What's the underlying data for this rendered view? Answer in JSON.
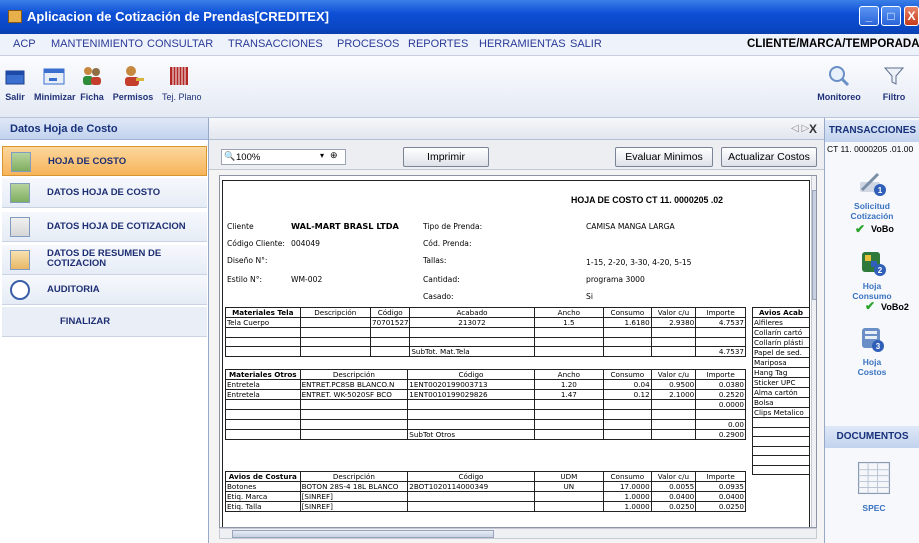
{
  "window": {
    "title": "Aplicacion de Cotización de Prendas[CREDITEX]",
    "minimize": "_",
    "maximize": "□",
    "close": "X"
  },
  "menu": {
    "items": [
      "ACP",
      "MANTENIMIENTO",
      "CONSULTAR",
      "TRANSACCIONES",
      "PROCESOS",
      "REPORTES",
      "HERRAMIENTAS",
      "SALIR"
    ],
    "context": "CLIENTE/MARCA/TEMPORADA"
  },
  "toolbar": {
    "left": [
      {
        "label": "Salir",
        "icon": "exit-icon"
      },
      {
        "label": "Minimizar",
        "icon": "minimize-window-icon"
      },
      {
        "label": "Ficha",
        "icon": "users-icon"
      },
      {
        "label": "Permisos",
        "icon": "user-key-icon"
      },
      {
        "label": "Tej. Plano",
        "icon": "barcode-icon"
      }
    ],
    "right": [
      {
        "label": "Monitoreo",
        "icon": "magnifier-icon"
      },
      {
        "label": "Filtro",
        "icon": "funnel-icon"
      }
    ]
  },
  "left_panel": {
    "title": "Datos Hoja de Costo",
    "items": [
      "HOJA DE COSTO",
      "DATOS HOJA DE COSTO",
      "DATOS HOJA DE COTIZACION",
      "DATOS DE RESUMEN DE COTIZACION",
      "AUDITORIA",
      "FINALIZAR"
    ],
    "active": "HOJA DE COSTO"
  },
  "doc": {
    "nav": "◁ ▷",
    "close": "X",
    "zoom": "100%",
    "print_btn": "Imprimir",
    "eval_btn": "Evaluar Minimos",
    "update_btn": "Actualizar Costos"
  },
  "report": {
    "title": "HOJA DE COSTO CT 11. 0000205 .02",
    "fields": [
      {
        "label": "Cliente",
        "value": "WAL-MART BRASL LTDA"
      },
      {
        "label": "Código Cliente:",
        "value": "004049"
      },
      {
        "label": "Diseño N°:",
        "value": ""
      },
      {
        "label": "Estilo N°:",
        "value": "WM-002"
      }
    ],
    "fields2": [
      {
        "label": "Tipo de Prenda:",
        "value": "CAMISA MANGA LARGA"
      },
      {
        "label": "Cód. Prenda:",
        "value": ""
      },
      {
        "label": "Tallas:",
        "value": "1-15, 2-20, 3-30, 4-20, 5-15"
      },
      {
        "label": "Cantidad:",
        "value": "programa 3000"
      },
      {
        "label": "Casado:",
        "value": "Si"
      }
    ],
    "telas": {
      "headers": [
        "Materiales Tela",
        "Descripción",
        "Código",
        "Acabado",
        "Ancho",
        "Consumo",
        "Valor c/u",
        "Importe"
      ],
      "rows": [
        [
          "Tela Cuerpo",
          "",
          "70701527",
          "213072",
          "1.5",
          "1.6180",
          "2.9380",
          "4.7537"
        ]
      ],
      "subtotal_label": "SubTot. Mat.Tela",
      "subtotal": "4.7537"
    },
    "otros": {
      "headers": [
        "Materiales Otros",
        "Descripción",
        "Código",
        "Ancho",
        "Consumo",
        "Valor c/u",
        "Importe"
      ],
      "rows": [
        [
          "Entretela",
          "ENTRET.PC8SB BLANCO.N",
          "1ENT0020199003713",
          "1.20",
          "0.04",
          "0.9500",
          "0.0380"
        ],
        [
          "Entretela",
          "ENTRET. WK-5020SF BCO",
          "1ENT0010199029826",
          "1.47",
          "0.12",
          "2.1000",
          "0.2520"
        ]
      ],
      "extra": [
        "0.0000",
        "0.00"
      ],
      "subtotal_label": "SubTot Otros",
      "subtotal": "0.2900"
    },
    "costura": {
      "headers": [
        "Avios de Costura",
        "Descripción",
        "Código",
        "UDM",
        "Consumo",
        "Valor c/u",
        "Importe"
      ],
      "rows": [
        [
          "Botones",
          "BOTON 28S-4 18L BLANCO",
          "2BOT1020114000349",
          "UN",
          "17.0000",
          "0.0055",
          "0.0935"
        ],
        [
          "Etiq. Marca",
          "[SINREF]",
          "",
          "",
          "1.0000",
          "0.0400",
          "0.0400"
        ],
        [
          "Etiq. Talla",
          "[SINREF]",
          "",
          "",
          "1.0000",
          "0.0250",
          "0.0250"
        ]
      ]
    },
    "acabado": {
      "header": "Avios Acab",
      "items": [
        "Alfileres",
        "Collarín cartó",
        "Collarín plásti",
        "Papel de sed.",
        "Mariposa",
        "Hang Tag",
        "Sticker UPC",
        "Alma cartón",
        "Bolsa",
        "Clips Metalico"
      ]
    }
  },
  "right_panel": {
    "section1": "TRANSACCIONES",
    "code": "CT 11. 0000205 .01.00",
    "items": [
      {
        "label": "Solicitud",
        "label2": "Cotización",
        "badge": "1",
        "vobo": "VoBo",
        "icon": "pen-pencil-icon"
      },
      {
        "label": "Hoja",
        "label2": "Consumo",
        "badge": "2",
        "vobo": "VoBo2",
        "icon": "color-palette-icon"
      },
      {
        "label": "Hoja",
        "label2": "Costos",
        "badge": "3",
        "icon": "cost-sheet-icon"
      }
    ],
    "section2": "DOCUMENTOS",
    "doc_label": "SPEC"
  }
}
